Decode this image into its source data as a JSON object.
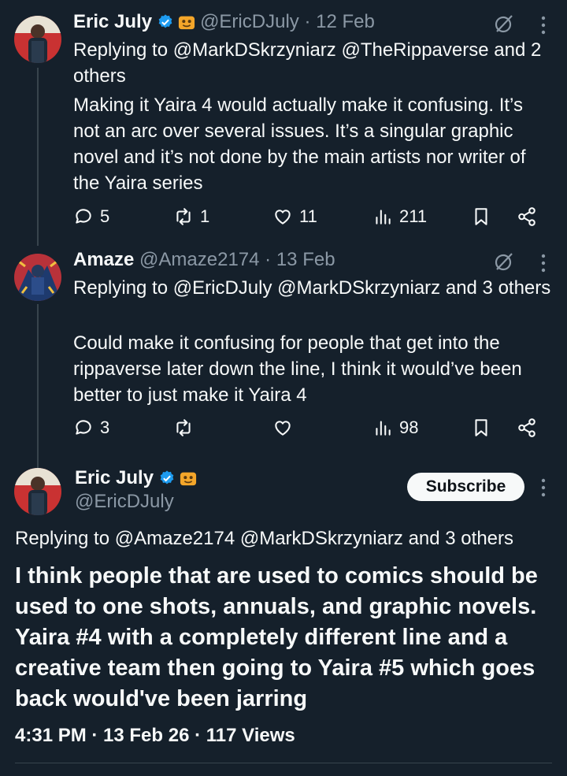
{
  "tweets": [
    {
      "author_name": "Eric July",
      "handle": "@EricDJuly",
      "date": "12 Feb",
      "reply_prefix": "Replying to",
      "reply_targets": "@MarkDSkrzyniarz @TheRippaverse and 2 others",
      "text": "Making it Yaira 4 would actually make it confusing. It’s not an arc over several issues. It’s a singular graphic novel and it’s not done by the main artists nor writer of the Yaira series",
      "replies": "5",
      "reposts": "1",
      "likes": "11",
      "views": "211"
    },
    {
      "author_name": "Amaze",
      "handle": "@Amaze2174",
      "date": "13 Feb",
      "reply_prefix": "Replying to",
      "reply_targets": "@EricDJuly @MarkDSkrzyniarz and 3 others",
      "text": "Could make it confusing for people that get into the rippaverse later down the line, I think it would’ve been better to just make it Yaira 4",
      "replies": "3",
      "reposts": "",
      "likes": "",
      "views": "98"
    }
  ],
  "main_tweet": {
    "author_name": "Eric July",
    "handle": "@EricDJuly",
    "subscribe_label": "Subscribe",
    "reply_line": "Replying to @Amaze2174 @MarkDSkrzyniarz and 3 others",
    "text": "I think people that are used to comics should be used to one shots, annuals, and graphic novels. Yaira #4 with a completely different line and a creative team then going to Yaira #5 which goes back would've been jarring",
    "meta": "4:31 PM · 13 Feb 26 · 117 Views"
  },
  "colors": {
    "background": "#15202b",
    "text": "#f7f9f9",
    "muted": "#8b98a5",
    "verified": "#1d9bf0",
    "divider": "#38444d"
  },
  "icons": [
    "verified-badge-icon",
    "emoji-badge-icon",
    "grok-icon",
    "more-icon",
    "reply-icon",
    "repost-icon",
    "like-icon",
    "views-icon",
    "bookmark-icon",
    "share-icon"
  ]
}
